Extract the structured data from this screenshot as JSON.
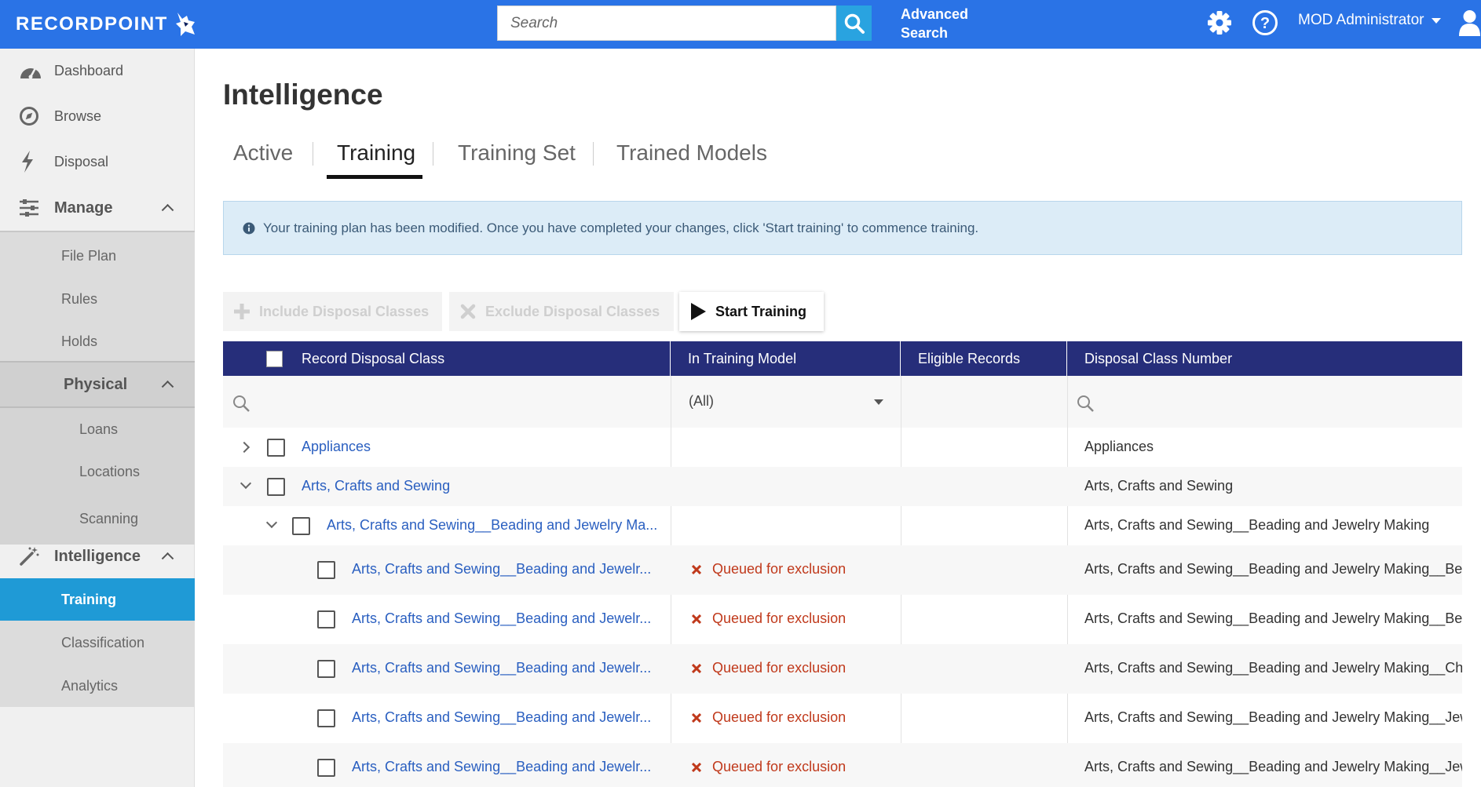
{
  "header": {
    "logo_text": "RECORDPOINT",
    "search_placeholder": "Search",
    "advanced_search_line1": "Advanced",
    "advanced_search_line2": "Search",
    "user_name": "MOD Administrator"
  },
  "sidebar": {
    "dashboard": "Dashboard",
    "browse": "Browse",
    "disposal": "Disposal",
    "manage": "Manage",
    "manage_items": [
      "File Plan",
      "Rules",
      "Holds"
    ],
    "physical": "Physical",
    "physical_items": [
      "Loans",
      "Locations",
      "Scanning"
    ],
    "intelligence": "Intelligence",
    "intelligence_items": [
      "Training",
      "Classification",
      "Analytics"
    ]
  },
  "main": {
    "title": "Intelligence",
    "tabs": [
      "Active",
      "Training",
      "Training Set",
      "Trained Models"
    ],
    "info_message": "Your training plan has been modified. Once you have completed your changes, click 'Start training' to commence training.",
    "toolbar": {
      "include": "Include Disposal Classes",
      "exclude": "Exclude Disposal Classes",
      "start": "Start Training"
    }
  },
  "grid": {
    "columns": [
      "Record Disposal Class",
      "In Training Model",
      "Eligible Records",
      "Disposal Class Number"
    ],
    "filter_select": "(All)",
    "rows": [
      {
        "name": "Appliances",
        "status": "",
        "number": "Appliances"
      },
      {
        "name": "Arts, Crafts and Sewing",
        "status": "",
        "number": "Arts, Crafts and Sewing"
      },
      {
        "name": "Arts, Crafts and Sewing__Beading and Jewelry Ma...",
        "status": "",
        "number": "Arts, Crafts and Sewing__Beading and Jewelry Making"
      },
      {
        "name": "Arts, Crafts and Sewing__Beading and Jewelr...",
        "status": "Queued for exclusion",
        "number": "Arts, Crafts and Sewing__Beading and Jewelry Making__Bea"
      },
      {
        "name": "Arts, Crafts and Sewing__Beading and Jewelr...",
        "status": "Queued for exclusion",
        "number": "Arts, Crafts and Sewing__Beading and Jewelry Making__Bea"
      },
      {
        "name": "Arts, Crafts and Sewing__Beading and Jewelr...",
        "status": "Queued for exclusion",
        "number": "Arts, Crafts and Sewing__Beading and Jewelry Making__Cha"
      },
      {
        "name": "Arts, Crafts and Sewing__Beading and Jewelr...",
        "status": "Queued for exclusion",
        "number": "Arts, Crafts and Sewing__Beading and Jewelry Making__Jew"
      },
      {
        "name": "Arts, Crafts and Sewing__Beading and Jewelr...",
        "status": "Queued for exclusion",
        "number": "Arts, Crafts and Sewing__Beading and Jewelry Making__Jew"
      }
    ]
  },
  "colors": {
    "topbar": "#2a73e6",
    "grid_header": "#262e7a",
    "active_nav": "#1f9ad6",
    "link": "#2a5fc0",
    "status_exclusion": "#c0391b"
  },
  "icons": [
    "wolf-logo-icon",
    "search-icon",
    "gear-icon",
    "help-icon",
    "user-icon",
    "dashboard-icon",
    "browse-icon",
    "disposal-icon",
    "manage-icon",
    "intelligence-icon",
    "info-icon",
    "plus-icon",
    "x-icon",
    "play-icon"
  ]
}
